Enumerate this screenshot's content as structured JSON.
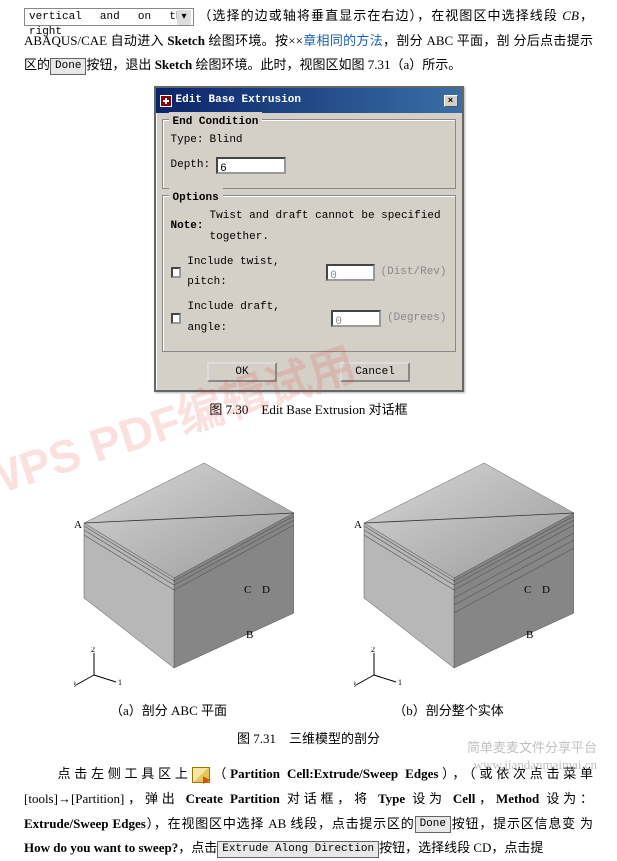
{
  "top": {
    "dropdown_value": "vertical and on the right",
    "line1_a": "（选择的边或轴将垂直显示在右边），在视图区中选择线段",
    "cb": "CB",
    "line2_a": "，ABAQUS/CAE 自动进入 ",
    "sketch": "Sketch",
    "line2_b": " 绘图环境。按××",
    "link": "章相同的方法",
    "line2_c": "，剖分 ABC 平面，剖",
    "line3_a": "分后点击提示区的",
    "done_btn": "Done",
    "line3_b": "按钮，退出 ",
    "line3_c": " 绘图环境。此时，视图区如图 7.31（a）所示。"
  },
  "dialog": {
    "title": "Edit Base Extrusion",
    "close": "×",
    "group1": "End Condition",
    "type_label": "Type:",
    "type_value": "Blind",
    "depth_label": "Depth:",
    "depth_value": "6",
    "group2": "Options",
    "note_label": "Note:",
    "note_text": "Twist and draft cannot be specified together.",
    "twist_label": "Include twist, pitch:",
    "twist_value": "0",
    "twist_unit": "(Dist/Rev)",
    "draft_label": "Include draft, angle:",
    "draft_value": "0",
    "draft_unit": "(Degrees)",
    "ok": "OK",
    "cancel": "Cancel"
  },
  "captions": {
    "c730": "图 7.30　Edit Base Extrusion 对话框",
    "sub_a": "（a）剖分 ABC 平面",
    "sub_b": "（b）剖分整个实体",
    "c731": "图 7.31　三维模型的剖分"
  },
  "fig": {
    "labels": [
      "A",
      "B",
      "C",
      "D"
    ],
    "axis": [
      "1",
      "2",
      "3"
    ]
  },
  "bottom": {
    "p1_a": "　　点击左侧工具区上",
    "p1_b": "（",
    "tool_bold": "Partition Cell:Extrude/Sweep Edges",
    "p1_c": "），（或依次点击菜单",
    "p2_a": "[tools]→[Partition]，弹出 ",
    "create_part": "Create Partition",
    "p2_b": " 对话框，将 ",
    "type": "Type",
    "p2_c": " 设为 ",
    "cell": "Cell",
    "p2_d": "，",
    "method": "Method",
    "p2_e": " 设为：",
    "extrude_bold": "Extrude/Sweep Edges",
    "p3_a": "），在视图区中选择 AB 线段，点击提示区的",
    "p3_b": "按钮，提示区信息变",
    "p4_a": "为 ",
    "how_sweep": "How do you want to sweep?",
    "p4_b": "，点击",
    "extrude_btn": "Extrude Along Direction",
    "p4_c": "按钮，选择线段 CD，点击提"
  },
  "watermark": {
    "w1": "WPS PDF编辑试用",
    "w2a": "简单麦麦文件分享平台",
    "w2b": "www.jiandanmaimai.cn"
  }
}
